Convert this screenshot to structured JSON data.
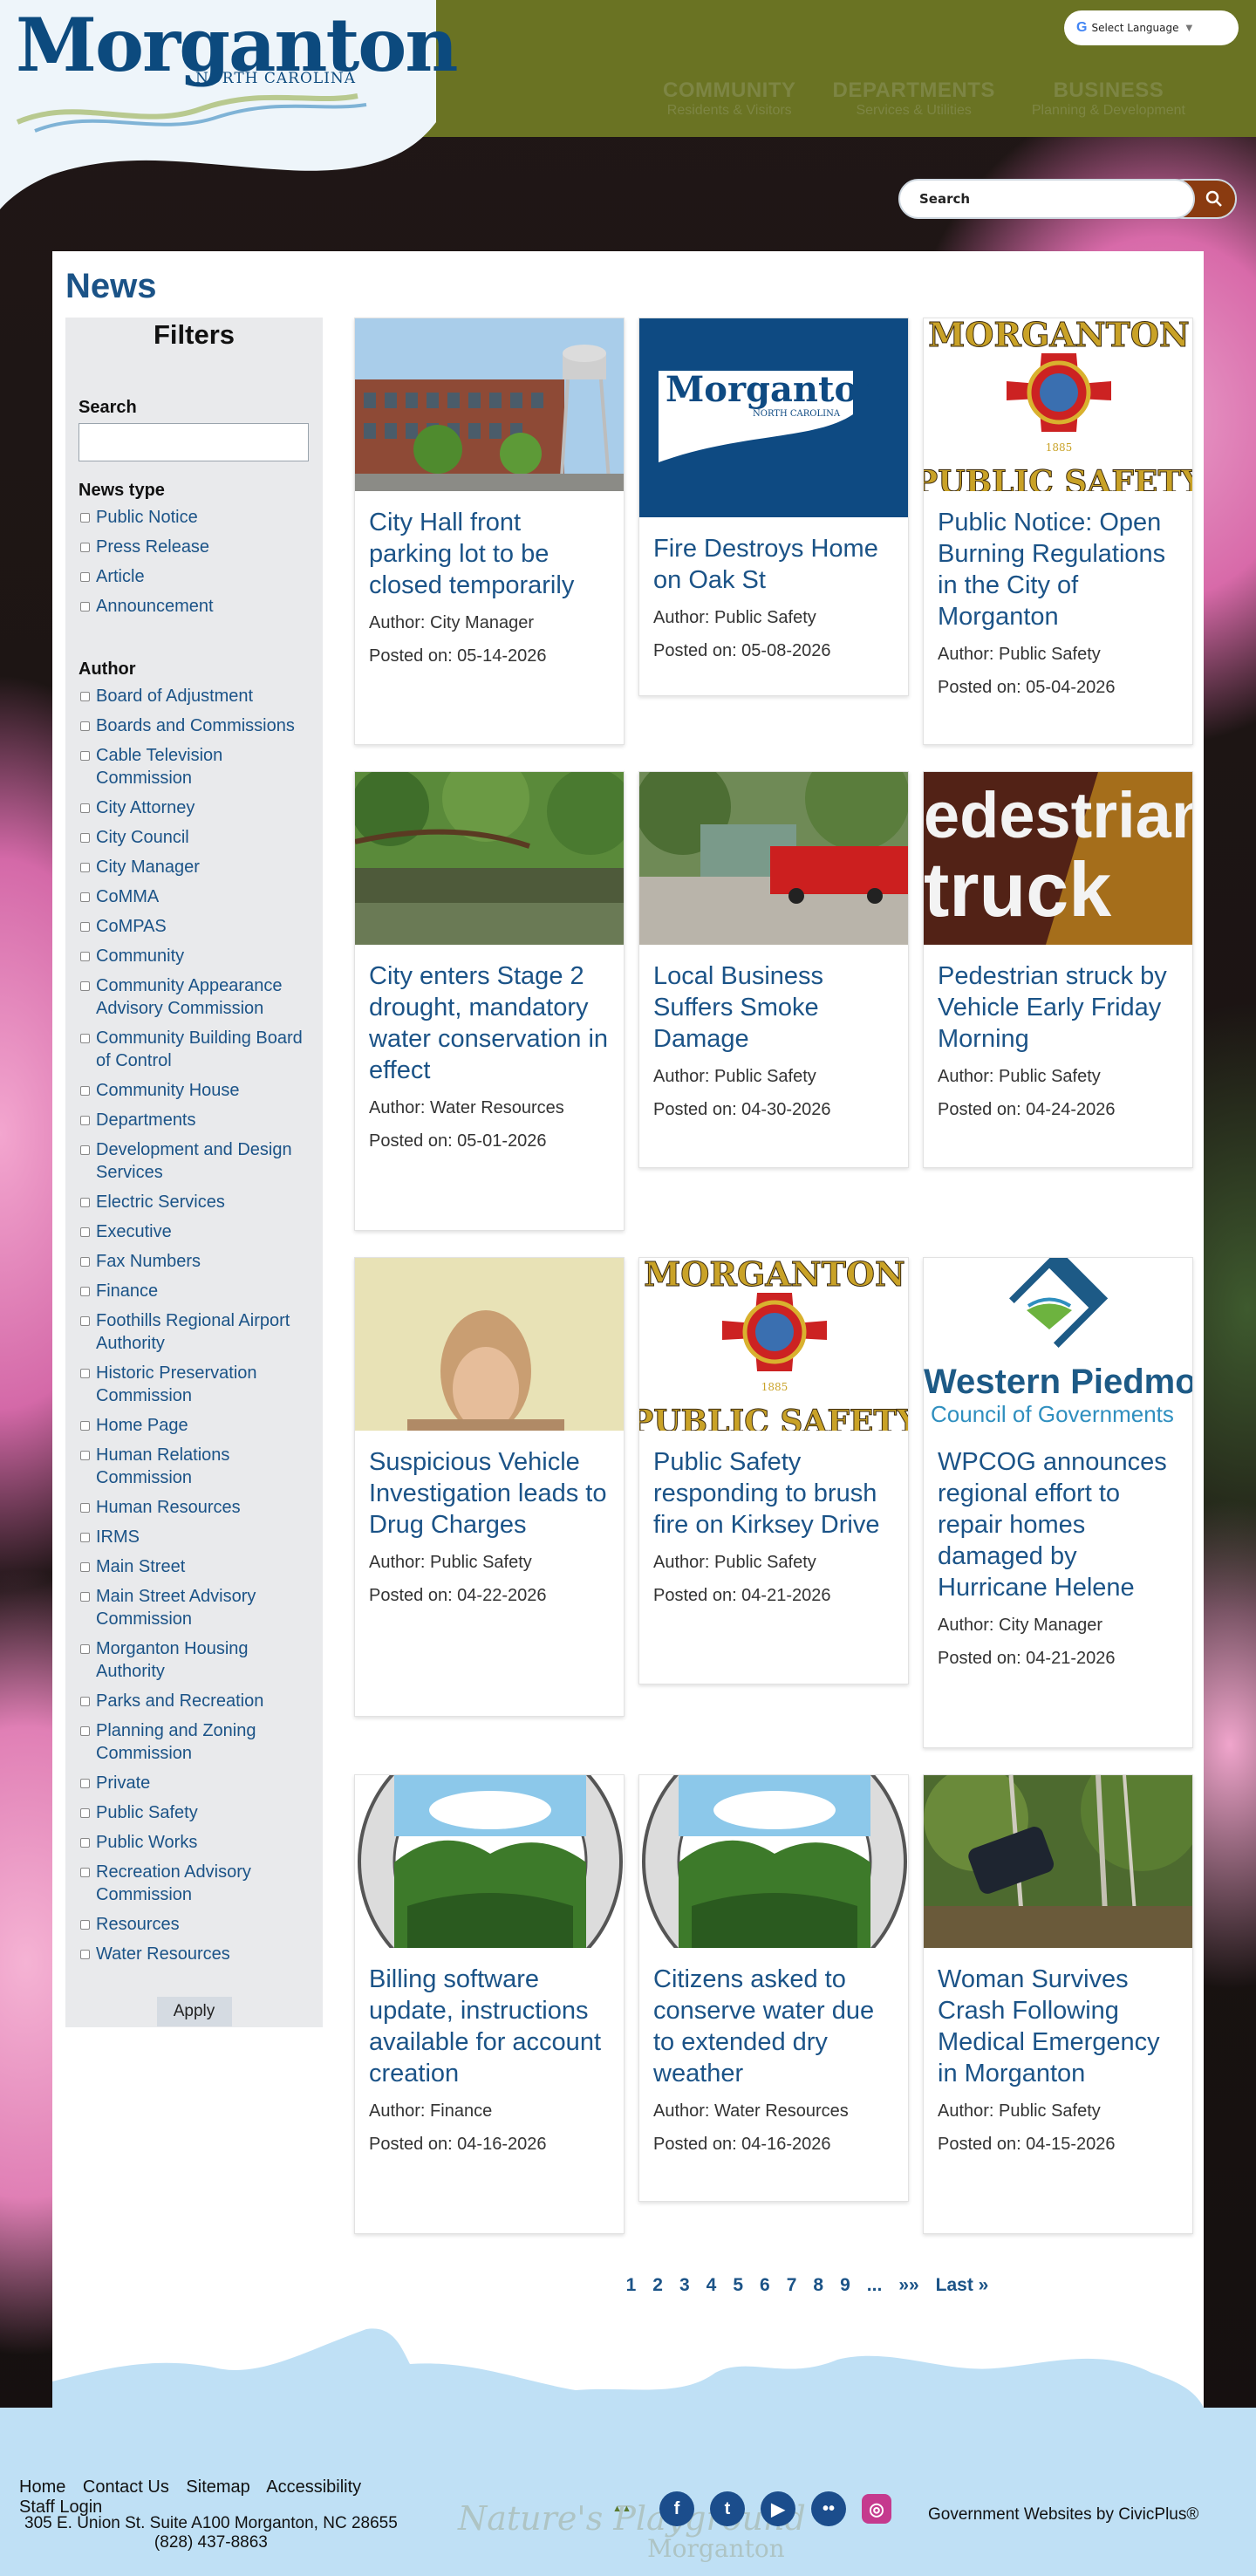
{
  "header": {
    "logo_title": "Morganton",
    "logo_subtitle": "NORTH CAROLINA",
    "translate_label": "Select Language",
    "nav": [
      {
        "title": "COMMUNITY",
        "sub": "Residents & Visitors"
      },
      {
        "title": "DEPARTMENTS",
        "sub": "Services & Utilities"
      },
      {
        "title": "BUSINESS",
        "sub": "Planning & Development"
      }
    ],
    "search_placeholder": "Search"
  },
  "page": {
    "title": "News"
  },
  "filters": {
    "heading": "Filters",
    "search_label": "Search",
    "news_type_label": "News type",
    "news_types": [
      "Public Notice",
      "Press Release",
      "Article",
      "Announcement"
    ],
    "author_label": "Author",
    "authors": [
      "Board of Adjustment",
      "Boards and Commissions",
      "Cable Television Commission",
      "City Attorney",
      "City Council",
      "City Manager",
      "CoMMA",
      "CoMPAS",
      "Community",
      "Community Appearance Advisory Commission",
      "Community Building Board of Control",
      "Community House",
      "Departments",
      "Development and Design Services",
      "Electric Services",
      "Executive",
      "Fax Numbers",
      "Finance",
      "Foothills Regional Airport Authority",
      "Historic Preservation Commission",
      "Home Page",
      "Human Relations Commission",
      "Human Resources",
      "IRMS",
      "Main Street",
      "Main Street Advisory Commission",
      "Morganton Housing Authority",
      "Parks and Recreation",
      "Planning and Zoning Commission",
      "Private",
      "Public Safety",
      "Public Works",
      "Recreation Advisory Commission",
      "Resources",
      "Water Resources"
    ],
    "apply_label": "Apply"
  },
  "news": [
    {
      "title": "City Hall front parking lot to be closed temporarily",
      "author": "Author: City Manager",
      "posted": "Posted on: 05-14-2026"
    },
    {
      "title": "Fire Destroys Home on Oak St",
      "author": "Author: Public Safety",
      "posted": "Posted on: 05-08-2026"
    },
    {
      "title": "Public Notice: Open Burning Regulations in the City of Morganton",
      "author": "Author: Public Safety",
      "posted": "Posted on: 05-04-2026"
    },
    {
      "title": "City enters Stage 2 drought, mandatory water conservation in effect",
      "author": "Author: Water Resources",
      "posted": "Posted on: 05-01-2026"
    },
    {
      "title": "Local Business Suffers Smoke Damage",
      "author": "Author: Public Safety",
      "posted": "Posted on: 04-30-2026"
    },
    {
      "title": "Pedestrian struck by Vehicle Early Friday Morning",
      "author": "Author: Public Safety",
      "posted": "Posted on: 04-24-2026"
    },
    {
      "title": "Suspicious Vehicle Investigation leads to Drug Charges",
      "author": "Author: Public Safety",
      "posted": "Posted on: 04-22-2026"
    },
    {
      "title": "Public Safety responding to brush fire on Kirksey Drive",
      "author": "Author: Public Safety",
      "posted": "Posted on: 04-21-2026"
    },
    {
      "title": "WPCOG announces regional effort to repair homes damaged by Hurricane Helene",
      "author": "Author: City Manager",
      "posted": "Posted on: 04-21-2026"
    },
    {
      "title": "Billing software update, instructions available for account creation",
      "author": "Author: Finance",
      "posted": "Posted on: 04-16-2026"
    },
    {
      "title": "Citizens asked to conserve water due to extended dry weather",
      "author": "Author: Water Resources",
      "posted": "Posted on: 04-16-2026"
    },
    {
      "title": "Woman Survives Crash Following Medical Emergency in Morganton",
      "author": "Author: Public Safety",
      "posted": "Posted on: 04-15-2026"
    }
  ],
  "thumb_text": {
    "logo_card_title": "Morganton",
    "logo_card_sub": "NORTH CAROLINA",
    "ps_top": "MORGANTON",
    "ps_bottom": "PUBLIC SAFETY",
    "ps_year": "1885",
    "pedestrian_line1": "edestrian",
    "pedestrian_line2": "truck",
    "wpcog_line1": "Western Piedmont",
    "wpcog_line2": "Council of Governments"
  },
  "pagination": [
    "1",
    "2",
    "3",
    "4",
    "5",
    "6",
    "7",
    "8",
    "9",
    "...",
    "»»",
    "Last »"
  ],
  "footer": {
    "links": [
      "Home",
      "Contact Us",
      "Sitemap",
      "Accessibility"
    ],
    "staff_login": "Staff Login",
    "address": "305 E. Union St. Suite A100 Morganton, NC 28655",
    "phone": "(828) 437-8863",
    "civicplus": "Government Websites by CivicPlus®",
    "nature_text": "Nature's Playground",
    "nature_sub": "Morganton"
  },
  "colors": {
    "header_olive": "#6a7323",
    "brand_blue": "#1b5387",
    "search_button": "#8a3b10"
  }
}
